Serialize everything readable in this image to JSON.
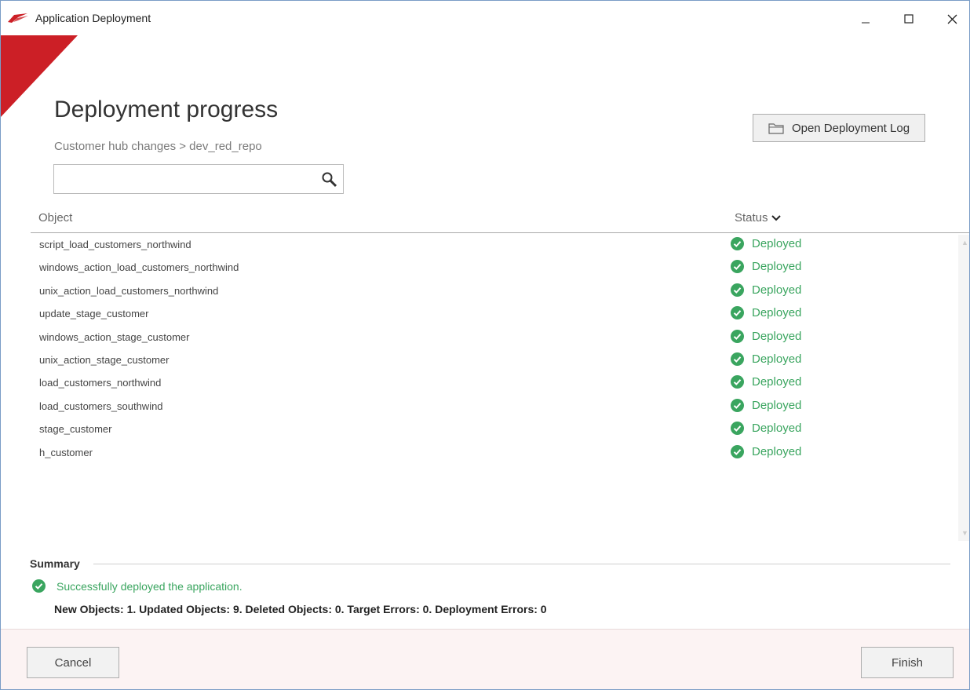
{
  "window": {
    "title": "Application Deployment",
    "accent_color": "#cc1f26"
  },
  "header": {
    "heading": "Deployment progress",
    "breadcrumb": "Customer hub changes > dev_red_repo",
    "open_log_label": "Open Deployment Log"
  },
  "search": {
    "value": "",
    "placeholder": ""
  },
  "table": {
    "columns": [
      "Object",
      "Status"
    ],
    "status_color": "#3aa55f",
    "rows": [
      {
        "object": "script_load_customers_northwind",
        "status": "Deployed"
      },
      {
        "object": "windows_action_load_customers_northwind",
        "status": "Deployed"
      },
      {
        "object": "unix_action_load_customers_northwind",
        "status": "Deployed"
      },
      {
        "object": "update_stage_customer",
        "status": "Deployed"
      },
      {
        "object": "windows_action_stage_customer",
        "status": "Deployed"
      },
      {
        "object": "unix_action_stage_customer",
        "status": "Deployed"
      },
      {
        "object": "load_customers_northwind",
        "status": "Deployed"
      },
      {
        "object": "load_customers_southwind",
        "status": "Deployed"
      },
      {
        "object": "stage_customer",
        "status": "Deployed"
      },
      {
        "object": "h_customer",
        "status": "Deployed"
      }
    ]
  },
  "summary": {
    "label": "Summary",
    "message": "Successfully deployed the application.",
    "counts": "New Objects: 1. Updated Objects: 9. Deleted Objects: 0. Target Errors: 0. Deployment Errors: 0"
  },
  "footer": {
    "cancel_label": "Cancel",
    "finish_label": "Finish"
  },
  "icons": [
    "app-logo-icon",
    "minimize-icon",
    "maximize-icon",
    "close-icon",
    "folder-icon",
    "search-icon",
    "chevron-down-icon",
    "check-circle-icon"
  ]
}
